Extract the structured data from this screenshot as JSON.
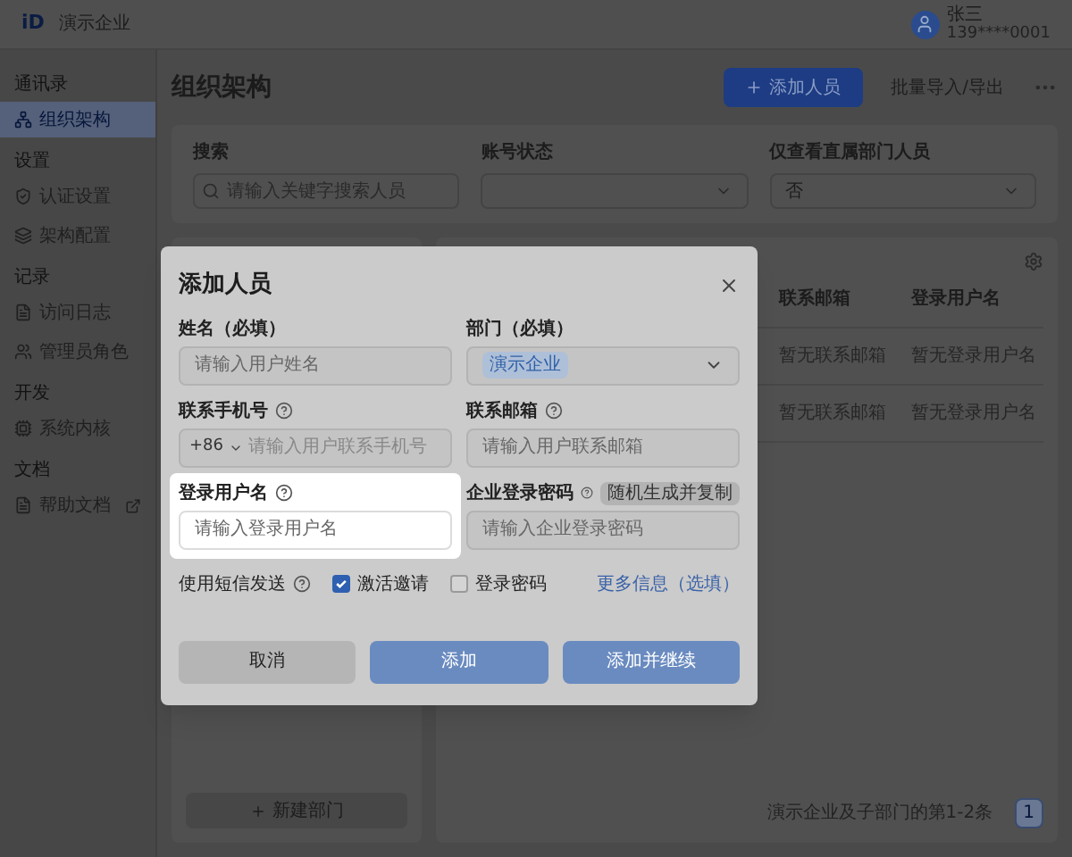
{
  "app": {
    "logo": "iD",
    "name": "演示企业"
  },
  "user": {
    "name": "张三",
    "account": "139****0001"
  },
  "sidebar": {
    "sections": [
      {
        "title": "通讯录",
        "items": [
          {
            "label": "组织架构",
            "selected": true,
            "external": false
          }
        ]
      },
      {
        "title": "设置",
        "items": [
          {
            "label": "认证设置",
            "selected": false,
            "external": false
          },
          {
            "label": "架构配置",
            "selected": false,
            "external": false
          }
        ]
      },
      {
        "title": "记录",
        "items": [
          {
            "label": "访问日志",
            "selected": false,
            "external": false
          },
          {
            "label": "管理员角色",
            "selected": false,
            "external": false
          }
        ]
      },
      {
        "title": "开发",
        "items": [
          {
            "label": "系统内核",
            "selected": false,
            "external": false
          }
        ]
      },
      {
        "title": "文档",
        "items": [
          {
            "label": "帮助文档",
            "selected": false,
            "external": true
          }
        ]
      }
    ]
  },
  "page": {
    "title": "组织架构",
    "buttons": [
      {
        "label": "添加人员",
        "kind": "primary"
      },
      {
        "label": "批量导入/导出",
        "kind": "text"
      }
    ]
  },
  "filters": [
    {
      "label": "搜索",
      "kind": "search",
      "placeholder": "请输入关键字搜索人员"
    },
    {
      "label": "账号状态",
      "kind": "select"
    },
    {
      "label": "仅查看直属部门人员",
      "kind": "select",
      "value": "否"
    }
  ],
  "department": {
    "new_button": "新建部门"
  },
  "table": {
    "columns": [
      "联系邮箱",
      "登录用户名"
    ],
    "rows": [
      [
        "暂无联系邮箱",
        "暂无登录用户名"
      ],
      [
        "暂无联系邮箱",
        "暂无登录用户名"
      ]
    ],
    "summary": "演示企业及子部门的第1-2条",
    "pages": [
      {
        "label": "1",
        "selected": true
      }
    ]
  },
  "dialog": {
    "title": "添加人员",
    "fields": [
      {
        "label": "姓名（必填）",
        "kind": "text",
        "placeholder": "请输入用户姓名",
        "help": false,
        "highlighted": false
      },
      {
        "label": "部门（必填）",
        "kind": "select",
        "value": "演示企业",
        "help": false,
        "highlighted": false
      },
      {
        "label": "联系手机号",
        "kind": "phone",
        "prefix": "+86",
        "placeholder": "请输入用户联系手机号",
        "help": true,
        "highlighted": false
      },
      {
        "label": "联系邮箱",
        "kind": "text",
        "placeholder": "请输入用户联系邮箱",
        "help": true,
        "highlighted": false
      },
      {
        "label": "登录用户名",
        "kind": "text",
        "placeholder": "请输入登录用户名",
        "help": true,
        "highlighted": true
      },
      {
        "label": "企业登录密码",
        "kind": "password",
        "placeholder": "请输入企业登录密码",
        "action": "随机生成并复制",
        "help": true,
        "highlighted": false
      }
    ],
    "sms": {
      "label": "使用短信发送",
      "help": true,
      "options": [
        {
          "label": "激活邀请",
          "checked": true
        },
        {
          "label": "登录密码",
          "checked": false
        }
      ]
    },
    "more_link": "更多信息（选填）",
    "buttons": [
      {
        "label": "取消",
        "kind": "secondary"
      },
      {
        "label": "添加",
        "kind": "primary"
      },
      {
        "label": "添加并继续",
        "kind": "primary"
      }
    ]
  }
}
